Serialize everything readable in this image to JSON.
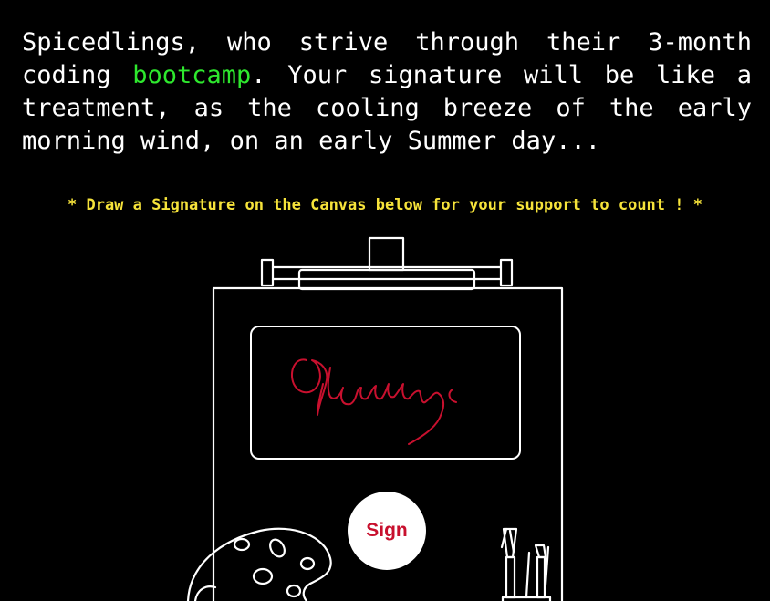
{
  "intro": {
    "text_before": "Spicedlings, who strive through their 3-month coding ",
    "highlight": "bootcamp",
    "text_after": ". Your signature will be like a treatment, as the cooling breeze of the early morning wind, on an early Summer day..."
  },
  "instruction": "* Draw a Signature on the Canvas below for your support to count ! *",
  "sign_button": {
    "label": "Sign"
  },
  "colors": {
    "background": "#000000",
    "text": "#ffffff",
    "highlight": "#2ee82e",
    "instruction": "#f6e33a",
    "signature_ink": "#c8102e",
    "button_text": "#c8102e"
  },
  "icons": [
    "easel-icon",
    "palette-icon",
    "brushes-icon"
  ]
}
